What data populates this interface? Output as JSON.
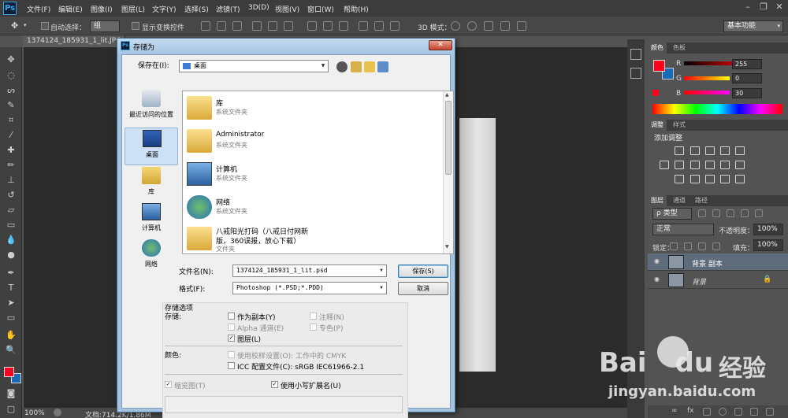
{
  "app": {
    "logo": "Ps"
  },
  "menubar": {
    "items": [
      "文件(F)",
      "编辑(E)",
      "图像(I)",
      "图层(L)",
      "文字(Y)",
      "选择(S)",
      "滤镜(T)",
      "3D(D)",
      "视图(V)",
      "窗口(W)",
      "帮助(H)"
    ]
  },
  "window_controls": {
    "minimize": "–",
    "restore": "❐",
    "close": "✕"
  },
  "options": {
    "auto_select_label": "自动选择：",
    "auto_select_value": "组",
    "show_transform_label": "显示变换控件",
    "mode3d_label": "3D 模式：",
    "workspace": "基本功能"
  },
  "document": {
    "tab_title": "1374124_185931_1_lit.JPG"
  },
  "status": {
    "zoom": "100%",
    "doc_info": "文档:714.2K/1.86M"
  },
  "color_panel": {
    "tabs": [
      "颜色",
      "色板"
    ],
    "r_label": "R",
    "g_label": "G",
    "b_label": "B",
    "r": "255",
    "g": "0",
    "b": "30",
    "foreground": "#ff001e",
    "background": "#1a6bb5"
  },
  "adjust_panel": {
    "tabs": [
      "调整",
      "样式"
    ],
    "title": "添加调整"
  },
  "layers_panel": {
    "tabs": [
      "图层",
      "通道",
      "路径"
    ],
    "filter_label": "类型",
    "blend_mode": "正常",
    "opacity_label": "不透明度：",
    "opacity": "100%",
    "lock_label": "锁定：",
    "fill_label": "填充：",
    "fill": "100%",
    "layers": [
      {
        "name": "背景 副本",
        "selected": true
      },
      {
        "name": "背景",
        "selected": false
      }
    ]
  },
  "dialog": {
    "title": "存储为",
    "save_in_label": "保存在(I):",
    "save_in_value": "桌面",
    "places": [
      "最近访问的位置",
      "桌面",
      "库",
      "计算机",
      "网络"
    ],
    "files": [
      {
        "name": "库",
        "desc": "系统文件夹"
      },
      {
        "name": "Administrator",
        "desc": "系统文件夹"
      },
      {
        "name": "计算机",
        "desc": "系统文件夹"
      },
      {
        "name": "网络",
        "desc": "系统文件夹"
      },
      {
        "name": "八戒阳光打码（八戒日付网新",
        "name2": "版，360误报，放心下载）",
        "desc": "文件夹"
      }
    ],
    "filename_label": "文件名(N):",
    "filename_value": "1374124_185931_1_lit.psd",
    "format_label": "格式(F):",
    "format_value": "Photoshop (*.PSD;*.PDD)",
    "save_button": "保存(S)",
    "cancel_button": "取消",
    "options_title": "存储选项",
    "store_label": "存储:",
    "opt_copy": "作为副本(Y)",
    "opt_notes": "注释(N)",
    "opt_alpha": "Alpha 通道(E)",
    "opt_spot": "专色(P)",
    "opt_layers": "图层(L)",
    "color_label": "颜色:",
    "opt_proof": "使用校样设置(O): 工作中的 CMYK",
    "opt_icc": "ICC 配置文件(C): sRGB IEC61966-2.1",
    "opt_thumb": "缩览图(T)",
    "opt_lower_ext": "使用小写扩展名(U)"
  },
  "watermark": {
    "brand": "Bai",
    "brand2": "du",
    "cn": "经验",
    "url": "jingyan.baidu.com"
  }
}
